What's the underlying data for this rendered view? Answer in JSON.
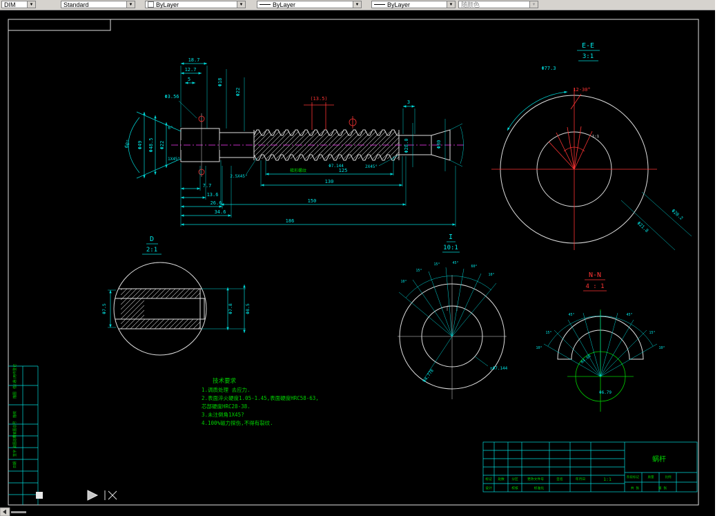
{
  "icons": {
    "dropdown": "▼"
  },
  "toolbar": {
    "dim_label": "DIM",
    "style": "Standard",
    "color": "ByLayer",
    "linetype": "ByLayer",
    "lineweight": "ByLayer",
    "plot_style": "随颜色"
  },
  "main": {
    "thread_label": "梯形螺纹",
    "dims": {
      "top": [
        "18.7",
        "12.7",
        "5",
        "Φ3.56",
        "Φ18",
        "Φ22",
        "(13.5)",
        "3"
      ],
      "left": [
        "60°",
        "Φ49",
        "Φ48.5",
        "Φ22",
        "6°",
        "1X45°"
      ],
      "stack": [
        "7.7",
        "13.6",
        "26.6",
        "34.6"
      ],
      "lengths": [
        "125",
        "130",
        "150",
        "186"
      ],
      "chamfers": [
        "2.5X45°",
        "Φ7.144",
        "2X45°"
      ],
      "right": [
        "Φ28.0",
        "Φ30"
      ]
    }
  },
  "detail_ee": {
    "label": "E-E",
    "scale": "3:1",
    "dia_outer": "Φ77.3",
    "slots": "12-30°",
    "taper": "1:1",
    "dia_1": "Φ21.8",
    "dia_2": "Φ20.2"
  },
  "detail_d": {
    "label": "D",
    "scale": "2:1",
    "dia_left": "Φ7.5",
    "dia_right_1": "Φ7.8",
    "dia_right_2": "Φ8.5"
  },
  "detail_i": {
    "label": "I",
    "scale": "10:1",
    "angles": [
      "10°",
      "15°",
      "15°",
      "45°",
      "60°",
      "10°"
    ],
    "dim_1": "±Φ7.144",
    "dim_2": "Φ4.778"
  },
  "detail_nn": {
    "label": "N-N",
    "scale": "4 : 1",
    "angles": [
      "45°",
      "45°",
      "15°",
      "15°",
      "10°",
      "10°"
    ],
    "dim_1": "R4.08",
    "dim_2": "Φ6.79"
  },
  "notes": {
    "title": "技术要求",
    "lines": [
      "1.调质处理 去应力.",
      "2.表面淬火硬度1.05-1.45,表面硬度HRC58-63,",
      "芯部硬度HRC28-38.",
      "3.未注倒角1X45?",
      "4.100%磁力探伤,不得有裂纹."
    ]
  },
  "title_block": {
    "part_name": "蜗杆",
    "scale_value": "1:1",
    "revision_row": [
      "标记",
      "处数",
      "分区",
      "更改文件号",
      "签名",
      "年月日"
    ],
    "sign_row": [
      "设计",
      "校核",
      "标准化"
    ],
    "right_labels": [
      "阶段标记",
      "质量",
      "比例"
    ],
    "sheet": [
      "共 张",
      "第 张"
    ]
  },
  "left_table": {
    "labels": [
      "借(通)用件登记",
      "描图",
      "描校",
      "旧底图总号",
      "底图总号",
      "签字",
      "日期"
    ]
  }
}
